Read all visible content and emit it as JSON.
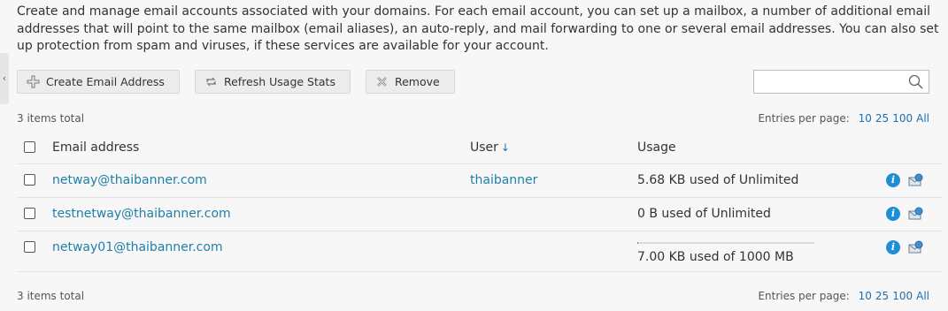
{
  "description": "Create and manage email accounts associated with your domains. For each email account, you can set up a mailbox, a number of additional email addresses that will point to the same mailbox (email aliases), an auto-reply, and mail forwarding to one or several email addresses. You can also set up protection from spam and viruses, if these services are available for your account.",
  "toolbar": {
    "create_label": "Create Email Address",
    "refresh_label": "Refresh Usage Stats",
    "remove_label": "Remove"
  },
  "search": {
    "placeholder": ""
  },
  "summary": {
    "total_top": "3 items total",
    "total_bottom": "3 items total",
    "entries_label": "Entries per page:",
    "page_options": [
      "10",
      "25",
      "100",
      "All"
    ]
  },
  "table": {
    "columns": {
      "email": "Email address",
      "user": "User",
      "usage": "Usage",
      "sort_indicator": "↓"
    },
    "rows": [
      {
        "email": "netway@thaibanner.com",
        "user": "thaibanner",
        "usage": "5.68 KB used of Unlimited"
      },
      {
        "email": "testnetway@thaibanner.com",
        "user": "",
        "usage": "0 B used of Unlimited"
      },
      {
        "email": "netway01@thaibanner.com",
        "user": "",
        "usage": "7.00 KB used of 1000 MB",
        "usage_fraction": 0.007
      }
    ]
  },
  "colors": {
    "link": "#1f7fa8",
    "info": "#1e8fd6",
    "button_bg": "#ececec"
  },
  "icons": [
    "chevron-left-icon",
    "plus-icon",
    "refresh-icon",
    "remove-icon",
    "search-icon",
    "info-icon",
    "mail-settings-icon"
  ]
}
